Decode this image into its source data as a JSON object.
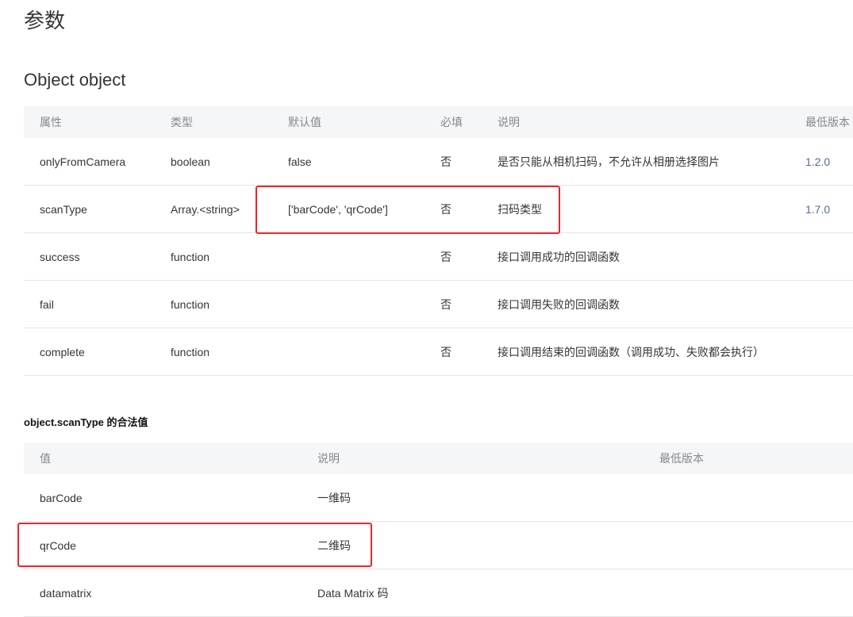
{
  "title": "参数",
  "section": "Object object",
  "table1": {
    "headers": [
      "属性",
      "类型",
      "默认值",
      "必填",
      "说明",
      "最低版本"
    ],
    "rows": [
      [
        "onlyFromCamera",
        "boolean",
        "false",
        "否",
        "是否只能从相机扫码，不允许从相册选择图片",
        "1.2.0"
      ],
      [
        "scanType",
        "Array.<string>",
        "['barCode', 'qrCode']",
        "否",
        "扫码类型",
        "1.7.0"
      ],
      [
        "success",
        "function",
        "",
        "否",
        "接口调用成功的回调函数",
        ""
      ],
      [
        "fail",
        "function",
        "",
        "否",
        "接口调用失败的回调函数",
        ""
      ],
      [
        "complete",
        "function",
        "",
        "否",
        "接口调用结束的回调函数（调用成功、失败都会执行）",
        ""
      ]
    ]
  },
  "subheading": "object.scanType 的合法值",
  "table2": {
    "headers": [
      "值",
      "说明",
      "最低版本"
    ],
    "rows": [
      [
        "barCode",
        "一维码",
        ""
      ],
      [
        "qrCode",
        "二维码",
        ""
      ],
      [
        "datamatrix",
        "Data Matrix 码",
        ""
      ]
    ]
  },
  "highlight_color": "#f2232b"
}
